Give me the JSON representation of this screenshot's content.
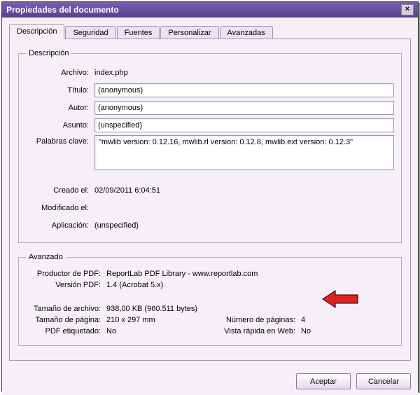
{
  "window": {
    "title": "Propiedades del documento",
    "close_symbol": "×"
  },
  "tabs": {
    "descripcion": "Descripción",
    "seguridad": "Seguridad",
    "fuentes": "Fuentes",
    "personalizar": "Personalizar",
    "avanzadas": "Avanzadas"
  },
  "descripcion_group": {
    "legend": "Descripción",
    "archivo_label": "Archivo:",
    "archivo_value": "index.php",
    "titulo_label": "Título:",
    "titulo_value": "(anonymous)",
    "autor_label": "Autor:",
    "autor_value": "(anonymous)",
    "asunto_label": "Asunto:",
    "asunto_value": "(unspecified)",
    "palabras_label": "Palabras clave:",
    "palabras_value": "\"mwlib version: 0.12.16, mwlib.rl version: 0.12.8, mwlib.ext version: 0.12.3\"",
    "creado_label": "Creado el:",
    "creado_value": "02/09/2011 6:04:51",
    "modificado_label": "Modificado el:",
    "modificado_value": "",
    "aplicacion_label": "Aplicación:",
    "aplicacion_value": "(unspecified)"
  },
  "avanzado_group": {
    "legend": "Avanzado",
    "productor_label": "Productor de PDF:",
    "productor_value": "ReportLab PDF Library - www.reportlab.com",
    "version_label": "Versión PDF:",
    "version_value": "1.4 (Acrobat 5.x)",
    "tamano_archivo_label": "Tamaño de archivo:",
    "tamano_archivo_value": "938,00 KB (960.511 bytes)",
    "tamano_pagina_label": "Tamaño de página:",
    "tamano_pagina_value": "210 x 297 mm",
    "etiquetado_label": "PDF etiquetado:",
    "etiquetado_value": "No",
    "num_paginas_label": "Número de páginas:",
    "num_paginas_value": "4",
    "vista_rapida_label": "Vista rápida en Web:",
    "vista_rapida_value": "No"
  },
  "buttons": {
    "aceptar": "Aceptar",
    "cancelar": "Cancelar"
  }
}
